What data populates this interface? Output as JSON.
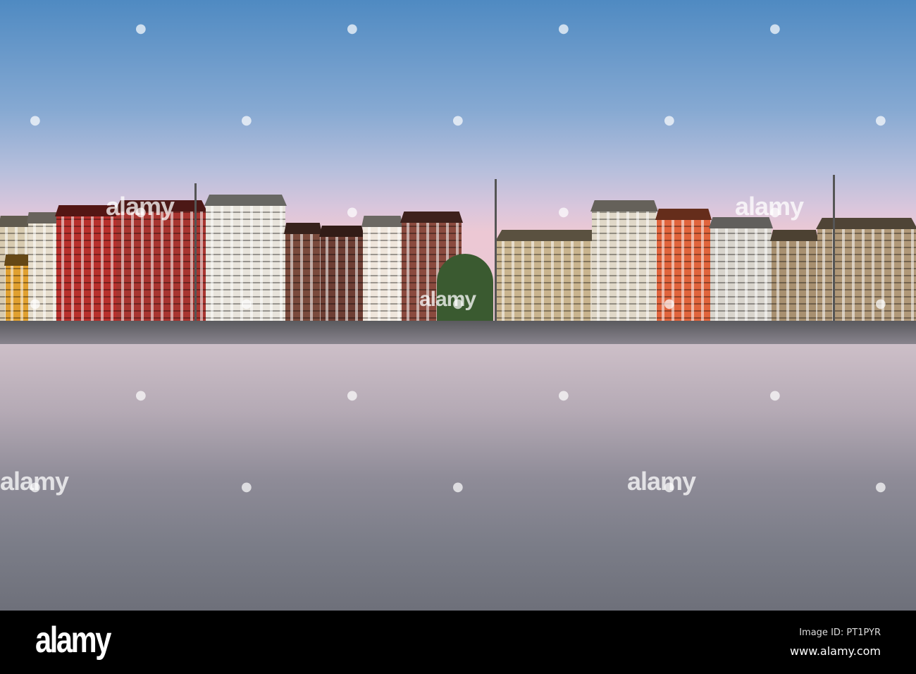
{
  "watermark": {
    "text": "alamy"
  },
  "footer": {
    "logo": "alamy",
    "image_id": "Image ID: PT1PYR",
    "website": "www.alamy.com"
  }
}
